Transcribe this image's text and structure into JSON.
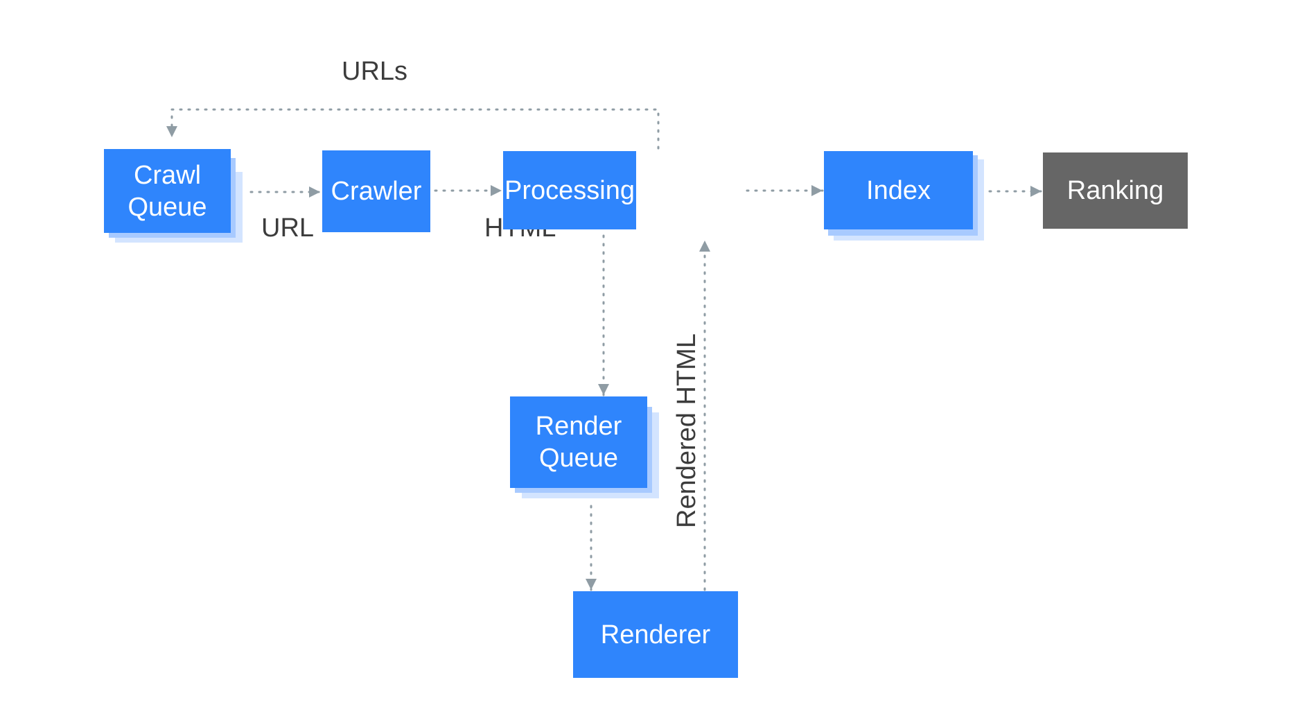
{
  "diagram": {
    "nodes": {
      "crawl_queue": {
        "line1": "Crawl",
        "line2": "Queue"
      },
      "crawler": {
        "label": "Crawler"
      },
      "processing": {
        "label": "Processing"
      },
      "index": {
        "label": "Index"
      },
      "ranking": {
        "label": "Ranking"
      },
      "render_queue": {
        "line1": "Render",
        "line2": "Queue"
      },
      "renderer": {
        "label": "Renderer"
      }
    },
    "edge_labels": {
      "urls": "URLs",
      "url": "URL",
      "html": "HTML",
      "rendered_html": "Rendered HTML"
    },
    "colors": {
      "node_blue": "#2f85fc",
      "node_gray": "#666666",
      "stack_shadow_1": "#a8caff",
      "stack_shadow_2": "#d3e4ff",
      "connector": "#8f9ca4",
      "label_text": "#3c3c3c"
    }
  }
}
